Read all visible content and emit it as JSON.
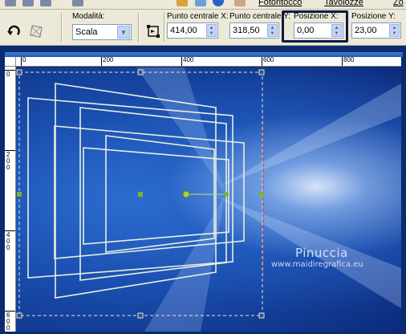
{
  "menubar": {
    "items": [
      "Fotoritocco",
      "Tavolozze",
      "Zo"
    ]
  },
  "options": {
    "mode_label": "Modalità:",
    "mode_value": "Scala",
    "center_x_label": "Punto centrale X:",
    "center_x_value": "414,00",
    "center_y_label": "Punto centrale Y:",
    "center_y_value": "318,50",
    "pos_x_label": "Posizione X:",
    "pos_x_value": "0,00",
    "pos_y_label": "Posizione Y:",
    "pos_y_value": "23,00"
  },
  "rulers": {
    "top_labels": [
      "0",
      "200",
      "400",
      "600",
      "800"
    ],
    "left_labels": [
      "0",
      "200",
      "400",
      "600"
    ]
  },
  "watermark": {
    "name": "Pinuccia",
    "url": "www.maidiregrafica.eu"
  },
  "colors": {
    "highlight": "#0d1a44",
    "handle": "#7fb22a",
    "frame_stroke": "#e8efe0",
    "ui_bg": "#ece9d8"
  }
}
